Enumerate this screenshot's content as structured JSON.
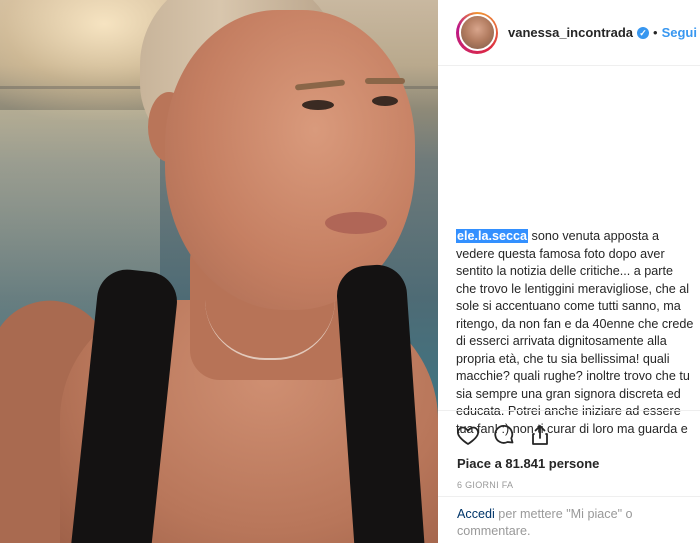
{
  "header": {
    "username": "vanessa_incontrada",
    "separator": "•",
    "follow_label": "Segui",
    "verified_mark": "✓"
  },
  "comment": {
    "username": "ele.la.secca",
    "text": " sono venuta apposta a vedere questa famosa foto dopo aver sentito la notizia delle critiche... a parte che trovo le lentiggini meravigliose, che al sole si accentuano come tutti sanno, ma ritengo, da non fan e da 40enne che crede di esserci arrivata dignitosamente alla propria età, che tu sia bellissima! quali macchie? quali rughe? inoltre trovo che tu sia sempre una gran signora discreta ed educata. Potrei anche iniziare ad essere tua fan! :) non ti curar di loro ma guarda e passa."
  },
  "actions": {
    "icons": [
      "heart-icon",
      "comment-icon",
      "share-icon"
    ]
  },
  "likes": "Piace a 81.841 persone",
  "date": "6 GIORNI FA",
  "login": {
    "link": "Accedi",
    "rest": " per mettere \"Mi piace\" o commentare."
  },
  "colors": {
    "accent": "#3897f0",
    "selection": "#3390ff",
    "link_dark": "#003569",
    "muted": "#999999"
  }
}
